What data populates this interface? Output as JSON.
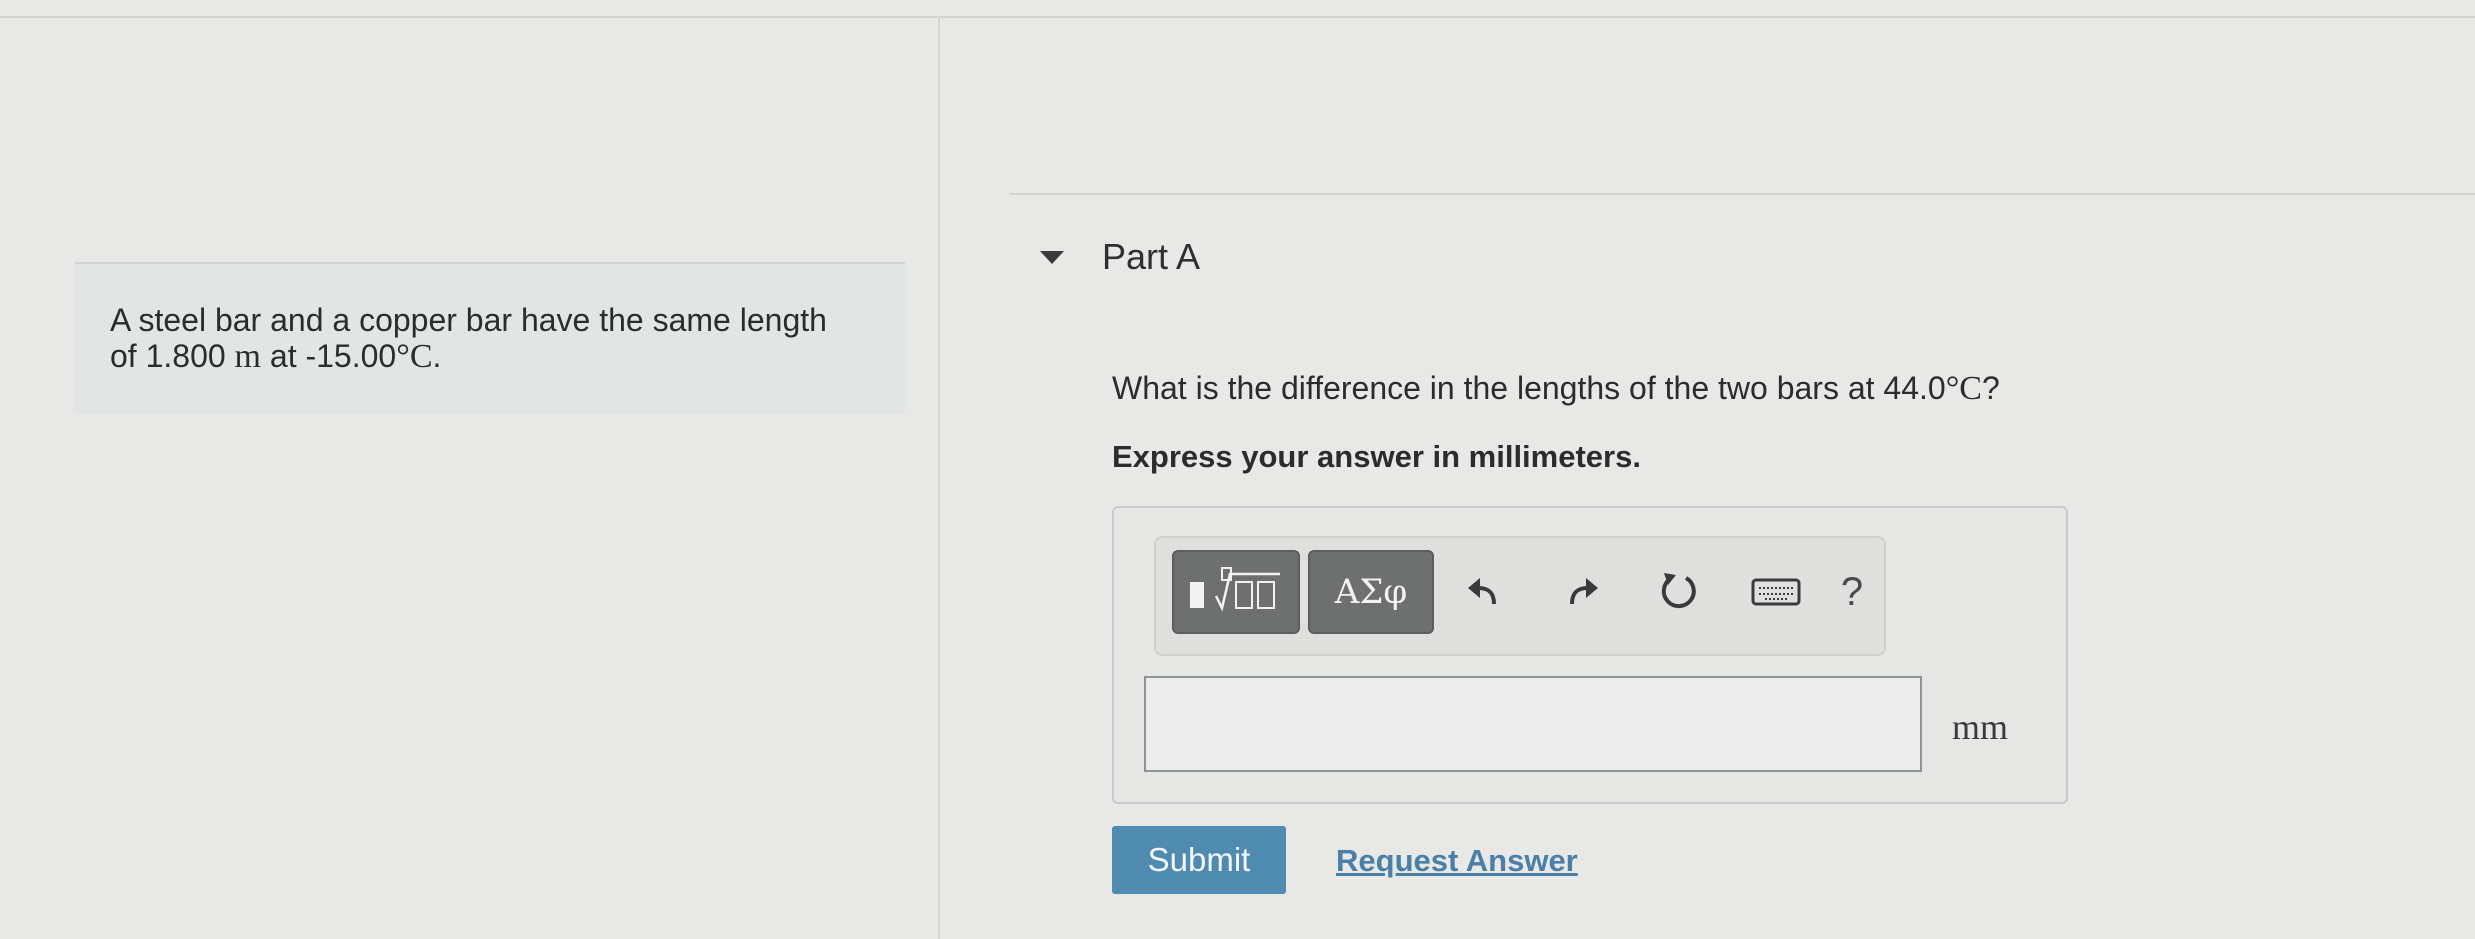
{
  "problem": {
    "line1": "A steel bar and a copper bar have the same length",
    "line2_prefix": "of 1.800",
    "length_unit": "m",
    "line2_mid": "at -15.00",
    "degree": "°",
    "temp_unit": "C",
    "line2_end": "."
  },
  "part": {
    "title": "Part A",
    "question_text": "What is the difference in the lengths of the two bars at 44.0",
    "question_degree": "°",
    "question_unit": "C",
    "question_end": "?",
    "instruction": "Express your answer in millimeters."
  },
  "toolbar": {
    "greek_label": "ΑΣφ",
    "help_label": "?",
    "icons": [
      "templates-icon",
      "undo-icon",
      "redo-icon",
      "reset-icon",
      "keyboard-icon",
      "help-icon"
    ]
  },
  "answer": {
    "value": "",
    "unit": "mm"
  },
  "actions": {
    "submit_label": "Submit",
    "request_label": "Request Answer"
  },
  "colors": {
    "submit_bg": "#4f8ab0",
    "link": "#4a7fa8",
    "toolbar_button": "#6e6f6f"
  }
}
